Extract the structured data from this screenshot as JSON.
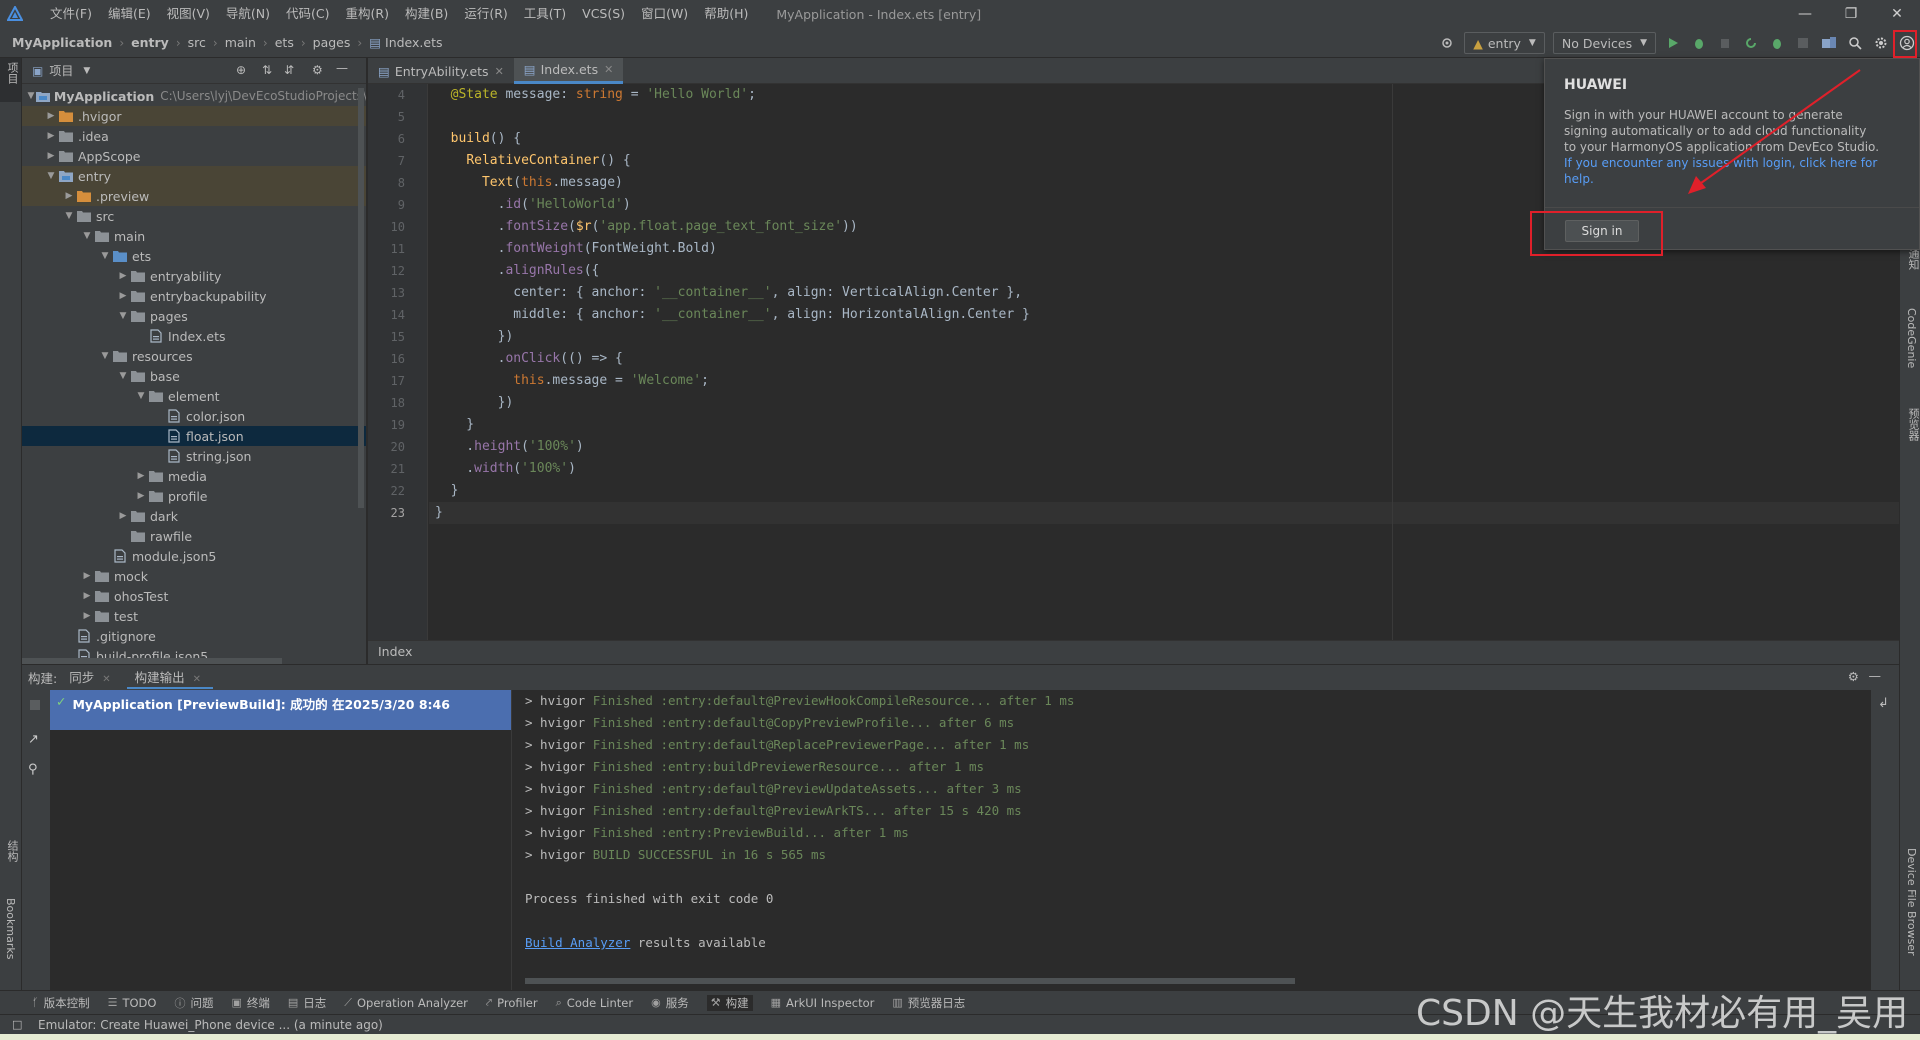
{
  "menu": {
    "items": [
      "文件(F)",
      "编辑(E)",
      "视图(V)",
      "导航(N)",
      "代码(C)",
      "重构(R)",
      "构建(B)",
      "运行(R)",
      "工具(T)",
      "VCS(S)",
      "窗口(W)",
      "帮助(H)"
    ],
    "window_title": "MyApplication - Index.ets [entry]"
  },
  "breadcrumb": [
    "MyApplication",
    "entry",
    "src",
    "main",
    "ets",
    "pages",
    "Index.ets"
  ],
  "toolbar": {
    "module_combo": "entry",
    "device_combo": "No Devices"
  },
  "project": {
    "header_label": "项目",
    "root_label": "MyApplication",
    "root_path": "C:\\Users\\lyj\\DevEcoStudioProjects\\",
    "tree": [
      {
        "label": ".hvigor",
        "depth": 1,
        "arrow": "›",
        "icon": "folder-orange",
        "state": "hl"
      },
      {
        "label": ".idea",
        "depth": 1,
        "arrow": "›",
        "icon": "folder",
        "state": ""
      },
      {
        "label": "AppScope",
        "depth": 1,
        "arrow": "›",
        "icon": "folder",
        "state": ""
      },
      {
        "label": "entry",
        "depth": 1,
        "arrow": "⌄",
        "icon": "folder-module",
        "state": "hl"
      },
      {
        "label": ".preview",
        "depth": 2,
        "arrow": "›",
        "icon": "folder-orange",
        "state": "hl"
      },
      {
        "label": "src",
        "depth": 2,
        "arrow": "⌄",
        "icon": "folder",
        "state": ""
      },
      {
        "label": "main",
        "depth": 3,
        "arrow": "⌄",
        "icon": "folder",
        "state": ""
      },
      {
        "label": "ets",
        "depth": 4,
        "arrow": "⌄",
        "icon": "folder-blue",
        "state": ""
      },
      {
        "label": "entryability",
        "depth": 5,
        "arrow": "›",
        "icon": "folder",
        "state": ""
      },
      {
        "label": "entrybackupability",
        "depth": 5,
        "arrow": "›",
        "icon": "folder",
        "state": ""
      },
      {
        "label": "pages",
        "depth": 5,
        "arrow": "⌄",
        "icon": "folder",
        "state": ""
      },
      {
        "label": "Index.ets",
        "depth": 6,
        "arrow": "",
        "icon": "file",
        "state": ""
      },
      {
        "label": "resources",
        "depth": 4,
        "arrow": "⌄",
        "icon": "folder",
        "state": ""
      },
      {
        "label": "base",
        "depth": 5,
        "arrow": "⌄",
        "icon": "folder",
        "state": ""
      },
      {
        "label": "element",
        "depth": 6,
        "arrow": "⌄",
        "icon": "folder",
        "state": ""
      },
      {
        "label": "color.json",
        "depth": 7,
        "arrow": "",
        "icon": "file",
        "state": ""
      },
      {
        "label": "float.json",
        "depth": 7,
        "arrow": "",
        "icon": "file",
        "state": "sel"
      },
      {
        "label": "string.json",
        "depth": 7,
        "arrow": "",
        "icon": "file",
        "state": ""
      },
      {
        "label": "media",
        "depth": 6,
        "arrow": "›",
        "icon": "folder",
        "state": ""
      },
      {
        "label": "profile",
        "depth": 6,
        "arrow": "›",
        "icon": "folder",
        "state": ""
      },
      {
        "label": "dark",
        "depth": 5,
        "arrow": "›",
        "icon": "folder",
        "state": ""
      },
      {
        "label": "rawfile",
        "depth": 5,
        "arrow": "",
        "icon": "folder",
        "state": ""
      },
      {
        "label": "module.json5",
        "depth": 4,
        "arrow": "",
        "icon": "file",
        "state": ""
      },
      {
        "label": "mock",
        "depth": 3,
        "arrow": "›",
        "icon": "folder",
        "state": ""
      },
      {
        "label": "ohosTest",
        "depth": 3,
        "arrow": "›",
        "icon": "folder",
        "state": ""
      },
      {
        "label": "test",
        "depth": 3,
        "arrow": "›",
        "icon": "folder",
        "state": ""
      },
      {
        "label": ".gitignore",
        "depth": 2,
        "arrow": "",
        "icon": "file",
        "state": ""
      },
      {
        "label": "build-profile.json5",
        "depth": 2,
        "arrow": "",
        "icon": "file",
        "state": ""
      }
    ]
  },
  "editor": {
    "tabs": [
      {
        "label": "EntryAbility.ets",
        "active": false
      },
      {
        "label": "Index.ets",
        "active": true
      }
    ],
    "line_numbers": [
      "4",
      "5",
      "6",
      "7",
      "8",
      "9",
      "10",
      "11",
      "12",
      "13",
      "14",
      "15",
      "16",
      "17",
      "18",
      "19",
      "20",
      "21",
      "22",
      "23"
    ],
    "current_line_index": 19,
    "code_lines": [
      [
        [
          "  ",
          ""
        ],
        [
          "@State",
          "a"
        ],
        [
          " message",
          ""
        ],
        [
          ": ",
          ""
        ],
        [
          "string",
          "k"
        ],
        [
          " = ",
          ""
        ],
        [
          "'Hello World'",
          "s"
        ],
        [
          ";",
          ""
        ]
      ],
      [],
      [
        [
          "  ",
          ""
        ],
        [
          "build",
          "f"
        ],
        [
          "() {",
          ""
        ]
      ],
      [
        [
          "    ",
          ""
        ],
        [
          "RelativeContainer",
          "f"
        ],
        [
          "() {",
          ""
        ]
      ],
      [
        [
          "      ",
          ""
        ],
        [
          "Text",
          "f"
        ],
        [
          "(",
          ""
        ],
        [
          "this",
          "k"
        ],
        [
          ".message",
          ""
        ],
        [
          ")",
          ""
        ]
      ],
      [
        [
          "        .",
          ""
        ],
        [
          "id",
          "p"
        ],
        [
          "(",
          ""
        ],
        [
          "'HelloWorld'",
          "s"
        ],
        [
          ")",
          ""
        ]
      ],
      [
        [
          "        .",
          ""
        ],
        [
          "fontSize",
          "p"
        ],
        [
          "(",
          ""
        ],
        [
          "$r",
          "f"
        ],
        [
          "(",
          ""
        ],
        [
          "'app.float.page_text_font_size'",
          "s"
        ],
        [
          "))",
          ""
        ]
      ],
      [
        [
          "        .",
          ""
        ],
        [
          "fontWeight",
          "p"
        ],
        [
          "(FontWeight.Bold)",
          ""
        ]
      ],
      [
        [
          "        .",
          ""
        ],
        [
          "alignRules",
          "p"
        ],
        [
          "({",
          ""
        ]
      ],
      [
        [
          "          center: { anchor: ",
          ""
        ],
        [
          "'__container__'",
          "s"
        ],
        [
          ", align: VerticalAlign.Center },",
          ""
        ]
      ],
      [
        [
          "          middle: { anchor: ",
          ""
        ],
        [
          "'__container__'",
          "s"
        ],
        [
          ", align: HorizontalAlign.Center }",
          ""
        ]
      ],
      [
        [
          "        })",
          ""
        ]
      ],
      [
        [
          "        .",
          ""
        ],
        [
          "onClick",
          "p"
        ],
        [
          "(() => {",
          ""
        ]
      ],
      [
        [
          "          ",
          ""
        ],
        [
          "this",
          "k"
        ],
        [
          ".message = ",
          ""
        ],
        [
          "'Welcome'",
          "s"
        ],
        [
          ";",
          ""
        ]
      ],
      [
        [
          "        })",
          ""
        ]
      ],
      [
        [
          "    }",
          ""
        ]
      ],
      [
        [
          "    .",
          ""
        ],
        [
          "height",
          "p"
        ],
        [
          "(",
          ""
        ],
        [
          "'100%'",
          "s"
        ],
        [
          ")",
          ""
        ]
      ],
      [
        [
          "    .",
          ""
        ],
        [
          "width",
          "p"
        ],
        [
          "(",
          ""
        ],
        [
          "'100%'",
          "s"
        ],
        [
          ")",
          ""
        ]
      ],
      [
        [
          "  }",
          ""
        ]
      ],
      [
        [
          "}",
          ""
        ]
      ]
    ],
    "crumb": "Index"
  },
  "build": {
    "label": "构建:",
    "tabs": [
      "同步",
      "构建输出"
    ],
    "result_row": "MyApplication [PreviewBuild]: 成功的 在2025/3/20 8:46",
    "output": [
      {
        "p": "> hvigor ",
        "g": "Finished :entry:default@PreviewHookCompileResource... after 1 ms"
      },
      {
        "p": "> hvigor ",
        "g": "Finished :entry:default@CopyPreviewProfile... after 6 ms"
      },
      {
        "p": "> hvigor ",
        "g": "Finished :entry:default@ReplacePreviewerPage... after 1 ms"
      },
      {
        "p": "> hvigor ",
        "g": "Finished :entry:buildPreviewerResource... after 1 ms"
      },
      {
        "p": "> hvigor ",
        "g": "Finished :entry:default@PreviewUpdateAssets... after 3 ms"
      },
      {
        "p": "> hvigor ",
        "g": "Finished :entry:default@PreviewArkTS... after 15 s 420 ms"
      },
      {
        "p": "> hvigor ",
        "g": "Finished :entry:PreviewBuild... after 1 ms"
      },
      {
        "p": "> hvigor ",
        "g": "BUILD SUCCESSFUL in 16 s 565 ms"
      },
      {
        "p": "",
        "g": ""
      },
      {
        "p": "Process finished with exit code 0",
        "g": ""
      },
      {
        "p": "",
        "g": ""
      }
    ],
    "analyzer_link": "Build Analyzer",
    "analyzer_rest": " results available"
  },
  "bottom_tools": [
    {
      "icon": "git-icon",
      "label": "版本控制"
    },
    {
      "icon": "todo-icon",
      "label": "TODO"
    },
    {
      "icon": "problems-icon",
      "label": "问题"
    },
    {
      "icon": "terminal-icon",
      "label": "终端"
    },
    {
      "icon": "log-icon",
      "label": "日志"
    },
    {
      "icon": "analyzer-icon",
      "label": "Operation Analyzer"
    },
    {
      "icon": "profiler-icon",
      "label": "Profiler"
    },
    {
      "icon": "linter-icon",
      "label": "Code Linter"
    },
    {
      "icon": "services-icon",
      "label": "服务"
    },
    {
      "icon": "build-icon",
      "label": "构建",
      "active": true
    },
    {
      "icon": "inspector-icon",
      "label": "ArkUI Inspector"
    },
    {
      "icon": "preview-log-icon",
      "label": "预览器日志"
    }
  ],
  "status_text": "Emulator: Create Huawei_Phone device ... (a minute ago)",
  "left_strip": {
    "project": "项目",
    "structure": "结构",
    "bookmarks": "Bookmarks"
  },
  "right_strip": {
    "notify": "通知",
    "codegenie": "CodeGenie",
    "preview": "预览器",
    "dfb": "Device File Browser"
  },
  "popup": {
    "title": "HUAWEI",
    "body": "Sign in with your HUAWEI account to generate signing automatically or to add cloud functionality to your HarmonyOS application from DevEco Studio.",
    "link": "If you encounter any issues with login, click here for help.",
    "signin": "Sign in"
  },
  "watermark": "CSDN @天生我材必有用_吴用"
}
